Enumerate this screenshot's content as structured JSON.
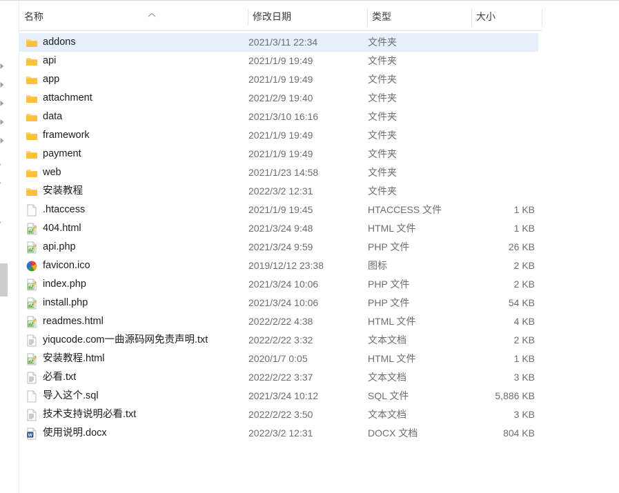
{
  "window": {
    "kind": "file-explorer-details-view"
  },
  "nav_pane": {
    "chevron_count": 5,
    "ghost_rows": 3,
    "scrollbar_visible": true
  },
  "columns": {
    "name": "名称",
    "date_modified": "修改日期",
    "type": "类型",
    "size": "大小",
    "sort_column": "名称",
    "sort_direction": "ascending"
  },
  "colors": {
    "selection": "#e5f0fb",
    "folder": "#ffc95b",
    "folder_tab": "#ffd886",
    "text_primary": "#1c1c1c",
    "text_secondary": "#6d6d6d",
    "separator": "#e2e2e2"
  },
  "files": [
    {
      "name": "addons",
      "date": "2021/3/11 22:34",
      "type": "文件夹",
      "size": "",
      "icon": "folder-icon",
      "selected": true
    },
    {
      "name": "api",
      "date": "2021/1/9 19:49",
      "type": "文件夹",
      "size": "",
      "icon": "folder-icon",
      "selected": false
    },
    {
      "name": "app",
      "date": "2021/1/9 19:49",
      "type": "文件夹",
      "size": "",
      "icon": "folder-icon",
      "selected": false
    },
    {
      "name": "attachment",
      "date": "2021/2/9 19:40",
      "type": "文件夹",
      "size": "",
      "icon": "folder-icon",
      "selected": false
    },
    {
      "name": "data",
      "date": "2021/3/10 16:16",
      "type": "文件夹",
      "size": "",
      "icon": "folder-icon",
      "selected": false
    },
    {
      "name": "framework",
      "date": "2021/1/9 19:49",
      "type": "文件夹",
      "size": "",
      "icon": "folder-icon",
      "selected": false
    },
    {
      "name": "payment",
      "date": "2021/1/9 19:49",
      "type": "文件夹",
      "size": "",
      "icon": "folder-icon",
      "selected": false
    },
    {
      "name": "web",
      "date": "2021/1/23 14:58",
      "type": "文件夹",
      "size": "",
      "icon": "folder-icon",
      "selected": false
    },
    {
      "name": "安装教程",
      "date": "2022/3/2 12:31",
      "type": "文件夹",
      "size": "",
      "icon": "folder-icon",
      "selected": false
    },
    {
      "name": ".htaccess",
      "date": "2021/1/9 19:45",
      "type": "HTACCESS 文件",
      "size": "1 KB",
      "icon": "blank-file-icon",
      "selected": false
    },
    {
      "name": "404.html",
      "date": "2021/3/24 9:48",
      "type": "HTML 文件",
      "size": "1 KB",
      "icon": "html-file-icon",
      "selected": false
    },
    {
      "name": "api.php",
      "date": "2021/3/24 9:59",
      "type": "PHP 文件",
      "size": "26 KB",
      "icon": "html-file-icon",
      "selected": false
    },
    {
      "name": "favicon.ico",
      "date": "2019/12/12 23:38",
      "type": "图标",
      "size": "2 KB",
      "icon": "ico-file-icon",
      "selected": false
    },
    {
      "name": "index.php",
      "date": "2021/3/24 10:06",
      "type": "PHP 文件",
      "size": "2 KB",
      "icon": "html-file-icon",
      "selected": false
    },
    {
      "name": "install.php",
      "date": "2021/3/24 10:06",
      "type": "PHP 文件",
      "size": "54 KB",
      "icon": "html-file-icon",
      "selected": false
    },
    {
      "name": "readmes.html",
      "date": "2022/2/22 4:38",
      "type": "HTML 文件",
      "size": "4 KB",
      "icon": "html-file-icon",
      "selected": false
    },
    {
      "name": "yiqucode.com一曲源码网免责声明.txt",
      "date": "2022/2/22 3:32",
      "type": "文本文档",
      "size": "2 KB",
      "icon": "text-file-icon",
      "selected": false
    },
    {
      "name": "安装教程.html",
      "date": "2020/1/7 0:05",
      "type": "HTML 文件",
      "size": "1 KB",
      "icon": "html-file-icon",
      "selected": false
    },
    {
      "name": "必看.txt",
      "date": "2022/2/22 3:37",
      "type": "文本文档",
      "size": "3 KB",
      "icon": "text-file-icon",
      "selected": false
    },
    {
      "name": "导入这个.sql",
      "date": "2021/3/24 10:12",
      "type": "SQL 文件",
      "size": "5,886 KB",
      "icon": "blank-file-icon",
      "selected": false
    },
    {
      "name": "技术支持说明必看.txt",
      "date": "2022/2/22 3:50",
      "type": "文本文档",
      "size": "3 KB",
      "icon": "text-file-icon",
      "selected": false
    },
    {
      "name": "使用说明.docx",
      "date": "2022/3/2 12:31",
      "type": "DOCX 文档",
      "size": "804 KB",
      "icon": "word-file-icon",
      "selected": false
    }
  ]
}
